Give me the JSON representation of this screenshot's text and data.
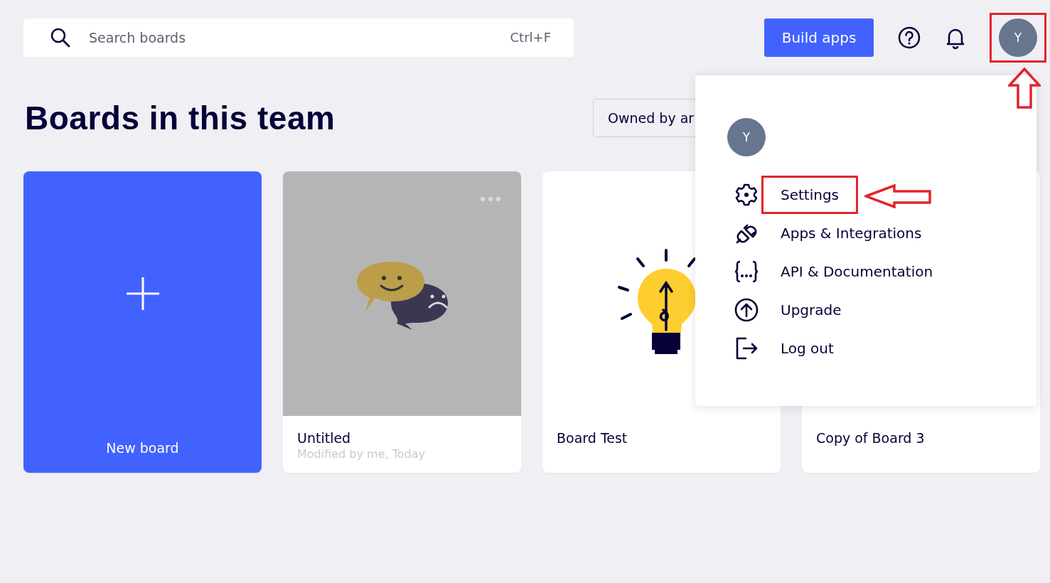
{
  "search": {
    "placeholder": "Search boards",
    "shortcut": "Ctrl+F"
  },
  "header": {
    "build_button": "Build apps",
    "avatar_initial": "Y"
  },
  "title": "Boards in this team",
  "filter": {
    "label": "Owned by ar"
  },
  "boards": [
    {
      "kind": "new",
      "title": "New board"
    },
    {
      "kind": "chat",
      "title": "Untitled",
      "subtitle": "Modified by me, Today"
    },
    {
      "kind": "bulb",
      "title": "Board Test"
    },
    {
      "kind": "plain",
      "title": "Copy of Board 3"
    }
  ],
  "account_menu": {
    "avatar_initial": "Y",
    "items": [
      {
        "kind": "settings",
        "label": "Settings"
      },
      {
        "kind": "apps",
        "label": "Apps & Integrations"
      },
      {
        "kind": "api",
        "label": "API & Documentation"
      },
      {
        "kind": "upgrade",
        "label": "Upgrade"
      },
      {
        "kind": "logout",
        "label": "Log out"
      }
    ]
  }
}
